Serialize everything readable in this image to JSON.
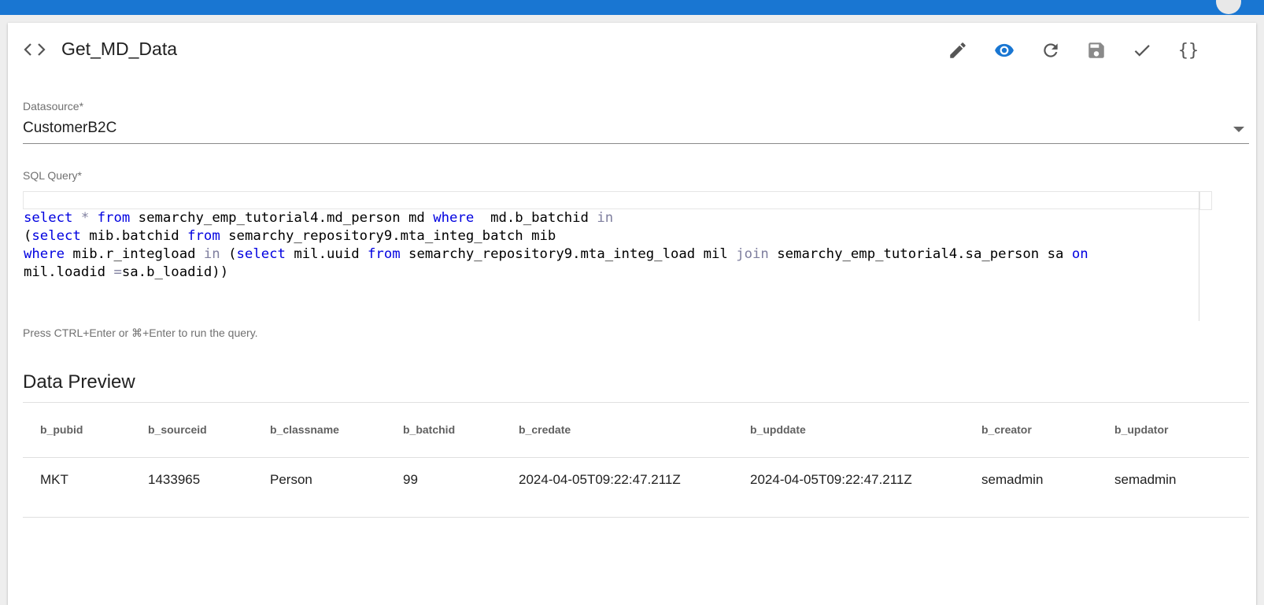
{
  "header": {
    "title": "Get_MD_Data",
    "toolbar": {
      "braces_label": "{}"
    }
  },
  "form": {
    "datasource": {
      "label": "Datasource*",
      "value": "CustomerB2C"
    },
    "sql": {
      "label": "SQL Query*",
      "lines": [
        "select * from semarchy_emp_tutorial4.md_person md where  md.b_batchid in",
        "(select mib.batchid from semarchy_repository9.mta_integ_batch mib",
        "where mib.r_integload in (select mil.uuid from semarchy_repository9.mta_integ_load mil join semarchy_emp_tutorial4.sa_person sa on",
        "mil.loadid =sa.b_loadid))"
      ]
    },
    "hint": "Press CTRL+Enter or ⌘+Enter to run the query."
  },
  "preview": {
    "title": "Data Preview",
    "columns": [
      "b_pubid",
      "b_sourceid",
      "b_classname",
      "b_batchid",
      "b_credate",
      "b_upddate",
      "b_creator",
      "b_updator"
    ],
    "rows": [
      [
        "MKT",
        "1433965",
        "Person",
        "99",
        "2024-04-05T09:22:47.211Z",
        "2024-04-05T09:22:47.211Z",
        "semadmin",
        "semadmin"
      ]
    ]
  },
  "colors": {
    "brand": "#1976d2",
    "active_icon": "#1976d2",
    "keyword": "#0000e0",
    "operator": "#7f7f9f"
  }
}
